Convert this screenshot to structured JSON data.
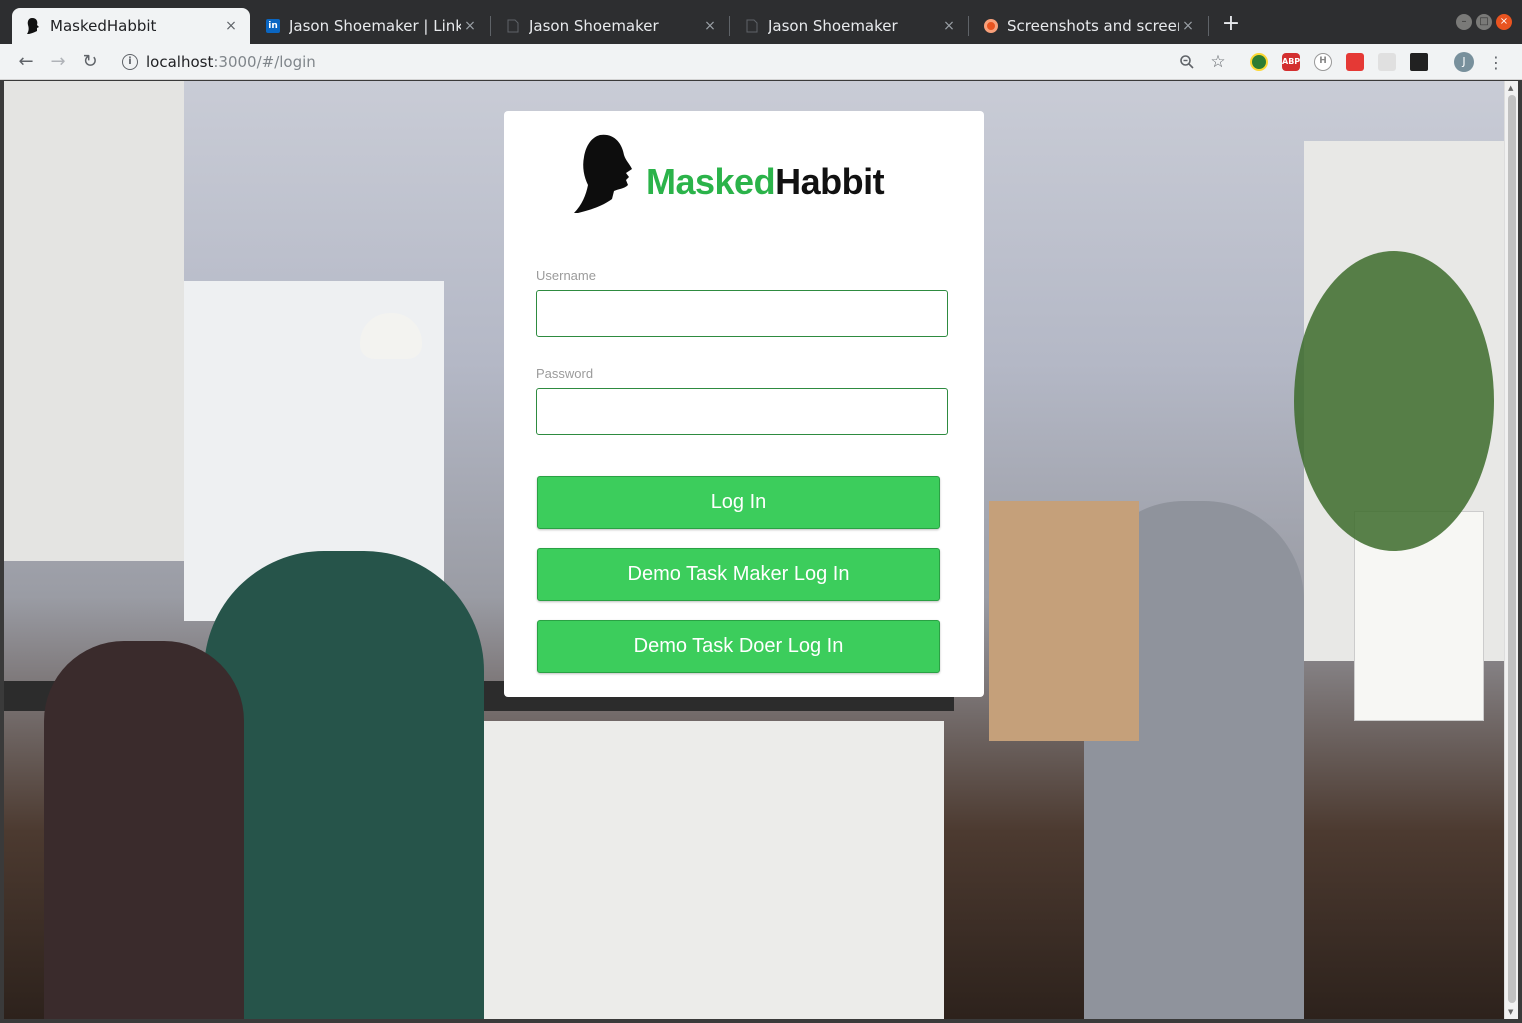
{
  "browser": {
    "tabs": [
      {
        "title": "MaskedHabbit",
        "favicon": "masked-silhouette-icon",
        "active": true
      },
      {
        "title": "Jason Shoemaker | Linked",
        "favicon": "linkedin-icon",
        "active": false
      },
      {
        "title": "Jason Shoemaker",
        "favicon": "page-icon",
        "active": false
      },
      {
        "title": "Jason Shoemaker",
        "favicon": "page-icon",
        "active": false
      },
      {
        "title": "Screenshots and screenca",
        "favicon": "ubuntu-icon",
        "active": false
      }
    ],
    "close_glyph": "×",
    "new_tab_glyph": "+",
    "url_host": "localhost",
    "url_rest": ":3000/#/login",
    "extensions": [
      {
        "name": "globe-extension-icon",
        "label": "",
        "color": "#2e7d32"
      },
      {
        "name": "adblock-plus-icon",
        "label": "ABP",
        "color": "#d32f2f"
      },
      {
        "name": "hypothesis-icon",
        "label": "H",
        "color": "#9e9e9e"
      },
      {
        "name": "red-extension-icon",
        "label": "",
        "color": "#e53935"
      },
      {
        "name": "grey-extension-icon",
        "label": "",
        "color": "#bdbdbd"
      },
      {
        "name": "zoom-extension-icon",
        "label": "",
        "color": "#212121"
      }
    ],
    "profile_initial": "J"
  },
  "login": {
    "logo_masked": "Masked",
    "logo_habbit": "Habbit",
    "username_label": "Username",
    "username_value": "",
    "password_label": "Password",
    "password_value": "",
    "login_button": "Log In",
    "demo_maker_button": "Demo Task Maker Log In",
    "demo_doer_button": "Demo Task Doer Log In"
  },
  "colors": {
    "accent_green": "#3ccd5c",
    "logo_green": "#2bb34a",
    "input_border": "#2e8b40"
  }
}
